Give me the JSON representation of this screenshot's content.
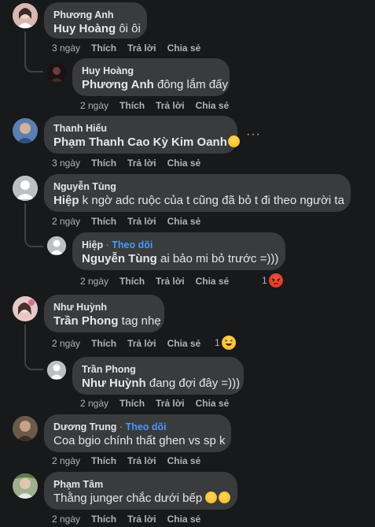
{
  "comments": [
    {
      "name": "Phương Anh",
      "mention": "Huy Hoàng",
      "text": " ôi ôi",
      "time": "3 ngày"
    },
    {
      "name": "Huy Hoàng",
      "mention": "Phương Anh",
      "text": " đông lắm đấy",
      "time": "2 ngày"
    },
    {
      "name": "Thanh Hiếu",
      "mention": "Phạm Thanh Cao Kỳ Kim Oanh",
      "text": "",
      "time": "3 ngày"
    },
    {
      "name": "Nguyễn Tùng",
      "mention": "Hiệp",
      "text": " k ngờ adc ruộc của t cũng đã bỏ t đi theo người ta",
      "time": "2 ngày"
    },
    {
      "name": "Hiệp",
      "follow": "Theo dõi",
      "mention": "Nguyễn Tùng",
      "text": " ai bảo mi bỏ trước =)))",
      "time": "2 ngày",
      "reactions": "1"
    },
    {
      "name": "Như Huỳnh",
      "mention": "Trần Phong",
      "text": " tag nhẹ",
      "time": "2 ngày",
      "reactions": "1"
    },
    {
      "name": "Trần Phong",
      "mention": "Như Huỳnh",
      "text": " đang đợi đây =)))",
      "time": "2 ngày"
    },
    {
      "name": "Dương Trung",
      "follow": "Theo dõi",
      "mention": "",
      "text": "Coa bgio chính thất ghen vs sp k",
      "time": "2 ngày"
    },
    {
      "name": "Phạm Tâm",
      "mention": "",
      "text": "Thằng junger chắc dưới bếp",
      "time": "2 ngày"
    }
  ],
  "actions": {
    "like": "Thích",
    "reply": "Trả lời",
    "share": "Chia sẻ"
  },
  "separator": "·",
  "more_label": "···",
  "colors": {
    "background": "#18191a",
    "bubble": "#3a3b3c",
    "link": "#4599ff",
    "muted": "#b0b3b8"
  }
}
